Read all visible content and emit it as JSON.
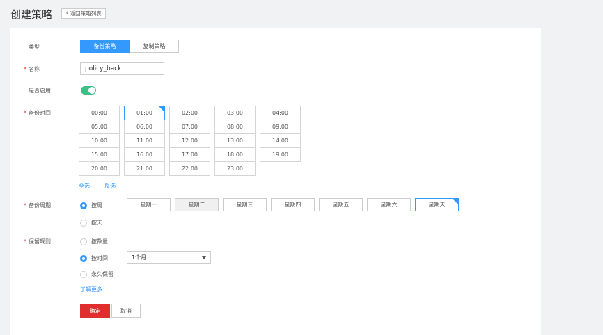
{
  "header": {
    "title": "创建策略",
    "back_label": "返回策略列表"
  },
  "form": {
    "type": {
      "label": "类型",
      "options": [
        "备份策略",
        "复制策略"
      ],
      "selected": "备份策略"
    },
    "name": {
      "label": "名称",
      "value": "policy_back"
    },
    "enabled": {
      "label": "是否启用",
      "on": true
    },
    "backup_time": {
      "label": "备份时间",
      "times": [
        "00:00",
        "01:00",
        "02:00",
        "03:00",
        "04:00",
        "05:00",
        "06:00",
        "07:00",
        "08:00",
        "09:00",
        "10:00",
        "11:00",
        "12:00",
        "13:00",
        "14:00",
        "15:00",
        "16:00",
        "17:00",
        "18:00",
        "19:00",
        "20:00",
        "21:00",
        "22:00",
        "23:00"
      ],
      "selected": [
        "01:00"
      ],
      "select_all": "全选",
      "invert": "反选"
    },
    "backup_cycle": {
      "label": "备份周期",
      "options": [
        "按周",
        "按天"
      ],
      "selected": "按周",
      "days": [
        "星期一",
        "星期二",
        "星期三",
        "星期四",
        "星期五",
        "星期六",
        "星期天"
      ],
      "selected_days": [
        "星期天"
      ]
    },
    "retention": {
      "label": "保留规则",
      "options": [
        "按数量",
        "按时间",
        "永久保留"
      ],
      "selected": "按时间",
      "time_value": "1个月",
      "learn_more": "了解更多"
    },
    "buttons": {
      "ok": "确定",
      "cancel": "取消"
    }
  },
  "colors": {
    "primary": "#3399ff",
    "danger": "#e02e2e",
    "toggle_on": "#3cbf86"
  }
}
